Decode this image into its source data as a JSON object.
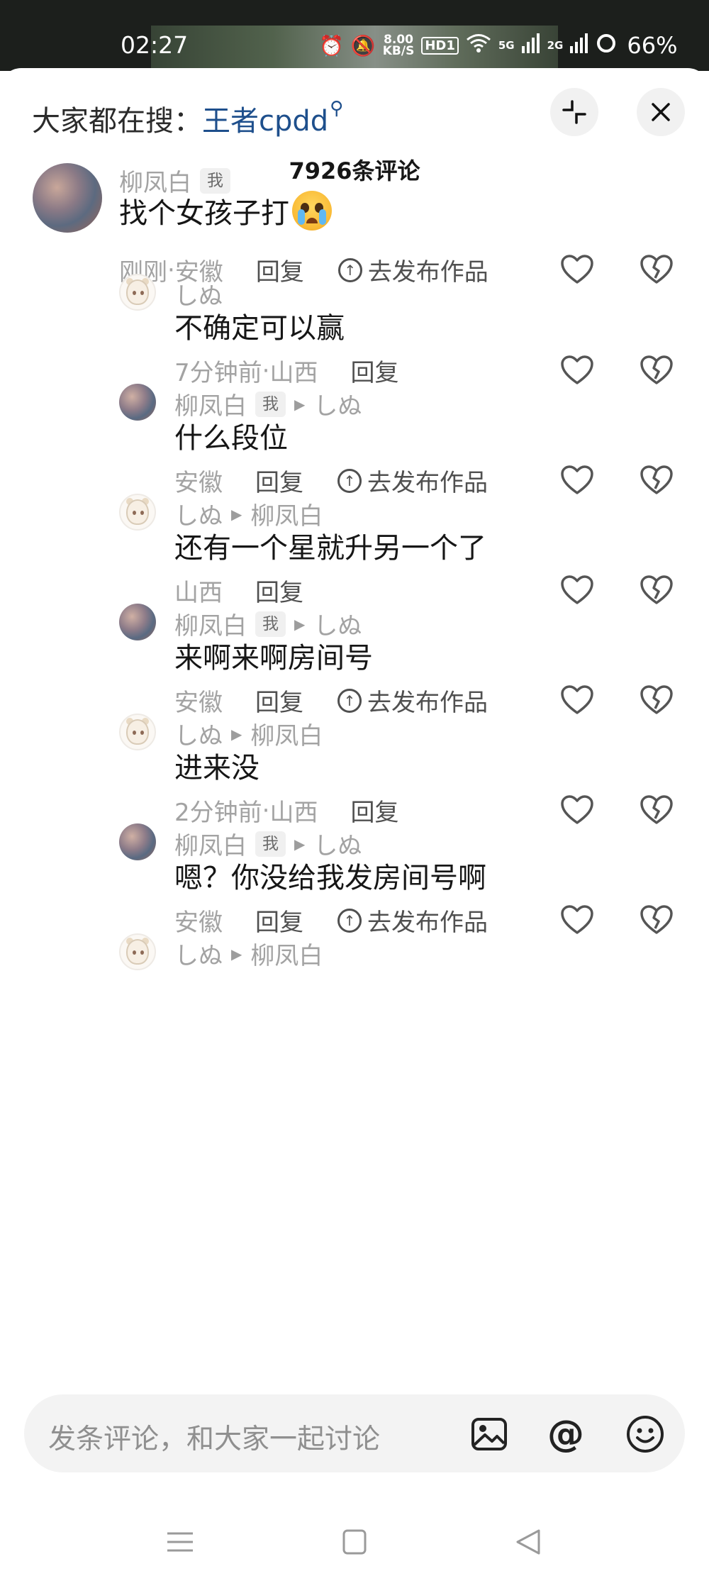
{
  "status_bar": {
    "time": "02:27",
    "net_speed_value": "8.00",
    "net_speed_unit": "KB/S",
    "hd": "HD1",
    "signal_5g": "5G",
    "signal_2g": "2G",
    "battery": "66%"
  },
  "header": {
    "search_prefix": "大家都在搜：",
    "search_term": "王者cpdd",
    "comment_count": "7926条评论"
  },
  "comments": [
    {
      "user": "柳凤白",
      "me_badge": "我",
      "text": "找个女孩子打",
      "time": "刚刚",
      "location": "安徽",
      "reply": "回复",
      "publish": "去发布作品"
    },
    {
      "user": "しぬ",
      "text": "不确定可以赢",
      "time": "7分钟前",
      "location": "山西",
      "reply": "回复"
    },
    {
      "user": "柳凤白",
      "me_badge": "我",
      "reply_to": "しぬ",
      "text": "什么段位",
      "location": "安徽",
      "reply": "回复",
      "publish": "去发布作品"
    },
    {
      "user": "しぬ",
      "reply_to": "柳凤白",
      "text": "还有一个星就升另一个了",
      "location": "山西",
      "reply": "回复"
    },
    {
      "user": "柳凤白",
      "me_badge": "我",
      "reply_to": "しぬ",
      "text": "来啊来啊房间号",
      "location": "安徽",
      "reply": "回复",
      "publish": "去发布作品"
    },
    {
      "user": "しぬ",
      "reply_to": "柳凤白",
      "text": "进来没",
      "time": "2分钟前",
      "location": "山西",
      "reply": "回复"
    },
    {
      "user": "柳凤白",
      "me_badge": "我",
      "reply_to": "しぬ",
      "text": "嗯？你没给我发房间号啊",
      "location": "安徽",
      "reply": "回复",
      "publish": "去发布作品"
    },
    {
      "user": "しぬ",
      "reply_to": "柳凤白"
    }
  ],
  "meta_separator": " · ",
  "input": {
    "placeholder": "发条评论，和大家一起讨论"
  },
  "icons": {
    "collapse": "collapse-icon",
    "close": "close-icon",
    "like": "heart-icon",
    "dislike": "broken-heart-icon",
    "image": "image-icon",
    "mention": "@",
    "emoji": "emoji-icon"
  }
}
